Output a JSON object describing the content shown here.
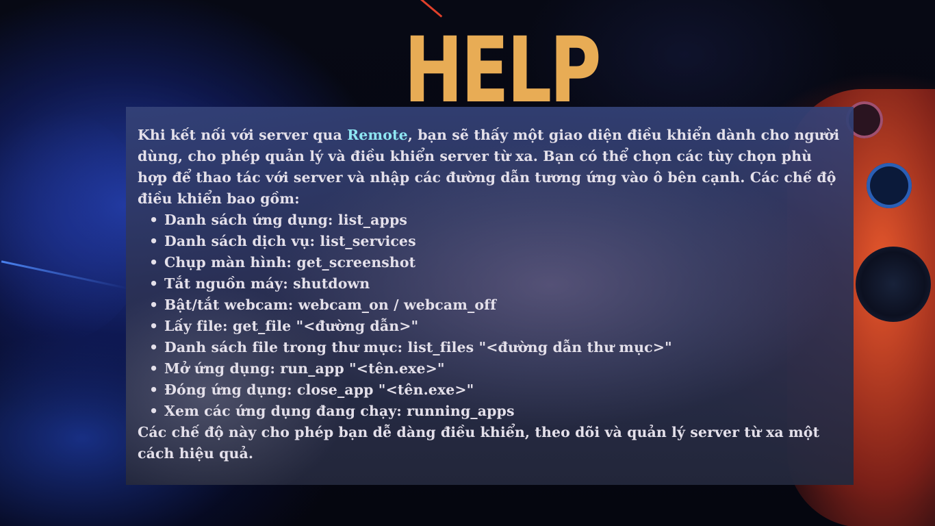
{
  "title": "HELP",
  "intro": {
    "before": "Khi kết nối với server qua ",
    "highlight": "Remote",
    "after": ", bạn sẽ thấy một giao diện điều khiển dành cho người dùng, cho phép quản lý và điều khiển server từ xa. Bạn có thể chọn các tùy chọn phù hợp để thao tác với server và nhập các đường dẫn tương ứng vào ô bên cạnh. Các chế độ điều khiển bao gồm:"
  },
  "commands": [
    "Danh sách ứng dụng: list_apps",
    "Danh sách dịch vụ: list_services",
    "Chụp màn hình: get_screenshot",
    "Tắt nguồn máy: shutdown",
    "Bật/tắt webcam: webcam_on / webcam_off",
    "Lấy file: get_file \"<đường dẫn>\"",
    "Danh sách file trong thư mục: list_files \"<đường dẫn thư mục>\"",
    "Mở ứng dụng: run_app \"<tên.exe>\"",
    "Đóng ứng dụng: close_app \"<tên.exe>\"",
    "Xem các ứng dụng đang chạy: running_apps"
  ],
  "outro": "Các chế độ này cho phép bạn dễ dàng điều khiển, theo dõi và quản lý server từ xa một cách hiệu quả.",
  "colors": {
    "title": "#e8ac55",
    "highlight": "#8ee6f2",
    "text": "#e4e0ea"
  }
}
